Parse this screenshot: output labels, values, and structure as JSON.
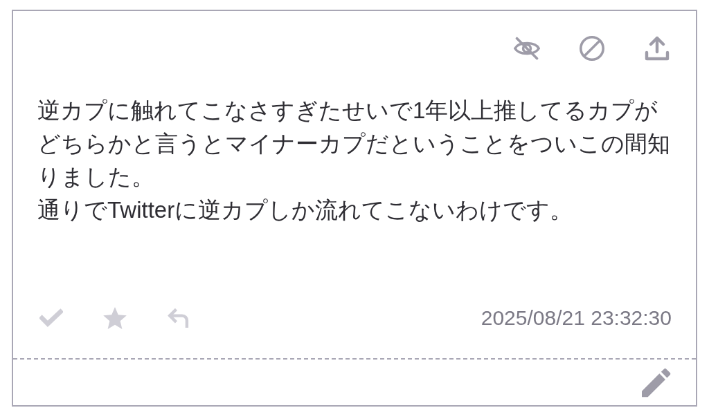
{
  "post": {
    "paragraphs": [
      "逆カプに触れてこなさすぎたせいで1年以上推してるカプがどちらかと言うとマイナーカプだということをついこの間知りました。",
      "通りでTwitterに逆カプしか流れてこないわけです。"
    ],
    "timestamp": "2025/08/21 23:32:30"
  }
}
